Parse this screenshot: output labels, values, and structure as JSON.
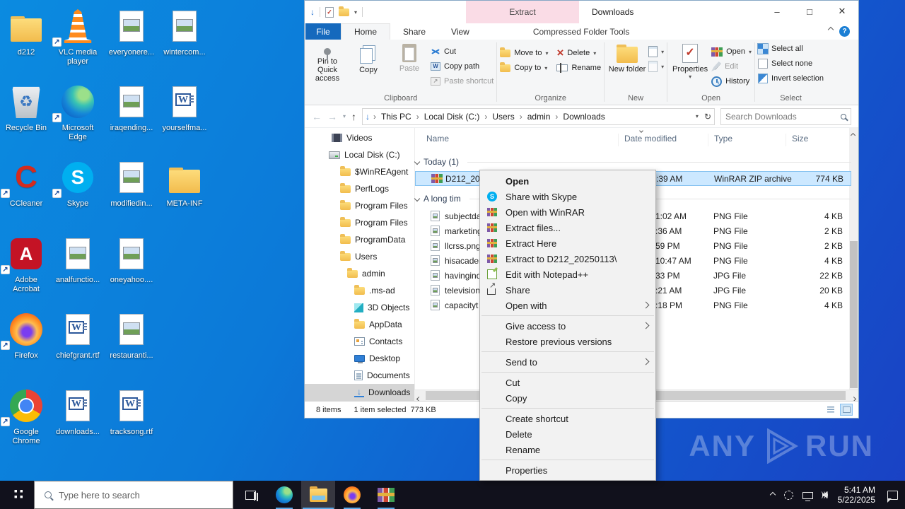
{
  "explorer": {
    "title": "Downloads",
    "contextual_header": "Extract",
    "contextual_tab": "Compressed Folder Tools",
    "tabs": [
      {
        "label": "File"
      },
      {
        "label": "Home"
      },
      {
        "label": "Share"
      },
      {
        "label": "View"
      }
    ],
    "ribbon": {
      "clipboard": {
        "pin": "Pin to Quick access",
        "copy": "Copy",
        "paste": "Paste",
        "cut": "Cut",
        "copy_path": "Copy path",
        "paste_shortcut": "Paste shortcut",
        "group": "Clipboard"
      },
      "organize": {
        "move_to": "Move to",
        "copy_to": "Copy to",
        "del": "Delete",
        "rename": "Rename",
        "group": "Organize"
      },
      "newgrp": {
        "new_folder": "New folder",
        "group": "New"
      },
      "opengrp": {
        "properties": "Properties",
        "open": "Open",
        "edit": "Edit",
        "history": "History",
        "group": "Open"
      },
      "selectgrp": {
        "select_all": "Select all",
        "select_none": "Select none",
        "invert": "Invert selection",
        "group": "Select"
      }
    },
    "address": {
      "breadcrumb": [
        "This PC",
        "Local Disk (C:)",
        "Users",
        "admin",
        "Downloads"
      ],
      "search_placeholder": "Search Downloads"
    },
    "columns": [
      "Name",
      "Date modified",
      "Type",
      "Size"
    ],
    "nav_items": [
      {
        "label": "Videos",
        "icon": "video",
        "indent": 38
      },
      {
        "label": "Local Disk (C:)",
        "icon": "disk",
        "indent": 34
      },
      {
        "label": "$WinREAgent",
        "icon": "folder",
        "indent": 50
      },
      {
        "label": "PerfLogs",
        "icon": "folder",
        "indent": 50
      },
      {
        "label": "Program Files",
        "icon": "folder",
        "indent": 50
      },
      {
        "label": "Program Files",
        "icon": "folder",
        "indent": 50
      },
      {
        "label": "ProgramData",
        "icon": "folder",
        "indent": 50
      },
      {
        "label": "Users",
        "icon": "folder",
        "indent": 50
      },
      {
        "label": "admin",
        "icon": "folder",
        "indent": 60
      },
      {
        "label": ".ms-ad",
        "icon": "folder",
        "indent": 70
      },
      {
        "label": "3D Objects",
        "icon": "cube",
        "indent": 70
      },
      {
        "label": "AppData",
        "icon": "folder",
        "indent": 70
      },
      {
        "label": "Contacts",
        "icon": "card",
        "indent": 70
      },
      {
        "label": "Desktop",
        "icon": "monitor",
        "indent": 70
      },
      {
        "label": "Documents",
        "icon": "doc",
        "indent": 70
      },
      {
        "label": "Downloads",
        "icon": "download",
        "indent": 70,
        "selected": true
      }
    ],
    "groups": [
      "Today (1)",
      "A long tim"
    ],
    "rows": [
      {
        "name": "D212_202",
        "date": ":39 AM",
        "type": "WinRAR ZIP archive",
        "size": "774 KB",
        "icon": "winrar",
        "selected": true
      },
      {
        "name": "subjectda",
        "date": "1:02 AM",
        "type": "PNG File",
        "size": "4 KB",
        "icon": "img"
      },
      {
        "name": "marketing",
        "date": ":36 AM",
        "type": "PNG File",
        "size": "2 KB",
        "icon": "img"
      },
      {
        "name": "llcrss.png",
        "date": "59 PM",
        "type": "PNG File",
        "size": "2 KB",
        "icon": "img"
      },
      {
        "name": "hisacader",
        "date": "10:47 AM",
        "type": "PNG File",
        "size": "4 KB",
        "icon": "img"
      },
      {
        "name": "havingind",
        "date": "33 PM",
        "type": "JPG File",
        "size": "22 KB",
        "icon": "img"
      },
      {
        "name": "television",
        "date": ":21 AM",
        "type": "JPG File",
        "size": "20 KB",
        "icon": "img"
      },
      {
        "name": "capacityt",
        "date": ":18 PM",
        "type": "PNG File",
        "size": "4 KB",
        "icon": "img"
      }
    ],
    "status": {
      "items_count": "8 items",
      "selection": "1 item selected",
      "selection_size": "773 KB"
    }
  },
  "context_menu": {
    "items": [
      {
        "label": "Open",
        "bold": true
      },
      {
        "label": "Share with Skype",
        "icon": "skype"
      },
      {
        "label": "Open with WinRAR",
        "icon": "winrar"
      },
      {
        "label": "Extract files...",
        "icon": "winrar"
      },
      {
        "label": "Extract Here",
        "icon": "winrar"
      },
      {
        "label": "Extract to D212_20250113\\",
        "icon": "winrar"
      },
      {
        "label": "Edit with Notepad++",
        "icon": "npp"
      },
      {
        "label": "Share",
        "icon": "share"
      },
      {
        "label": "Open with",
        "submenu": true
      },
      {
        "separator": true
      },
      {
        "label": "Give access to",
        "submenu": true
      },
      {
        "label": "Restore previous versions"
      },
      {
        "separator": true
      },
      {
        "label": "Send to",
        "submenu": true
      },
      {
        "separator": true
      },
      {
        "label": "Cut"
      },
      {
        "label": "Copy"
      },
      {
        "separator": true
      },
      {
        "label": "Create shortcut"
      },
      {
        "label": "Delete"
      },
      {
        "label": "Rename"
      },
      {
        "separator": true
      },
      {
        "label": "Properties"
      }
    ]
  },
  "desktop": {
    "icons": [
      {
        "label": "d212",
        "type": "folder",
        "col": 1,
        "row": 1
      },
      {
        "label": "VLC media player",
        "type": "vlc",
        "col": 2,
        "row": 1,
        "shortcut": true
      },
      {
        "label": "everyonere...",
        "type": "img",
        "col": 3,
        "row": 1
      },
      {
        "label": "wintercom...",
        "type": "img",
        "col": 4,
        "row": 1
      },
      {
        "label": "Recycle Bin",
        "type": "bin",
        "col": 1,
        "row": 2
      },
      {
        "label": "Microsoft Edge",
        "type": "edge",
        "col": 2,
        "row": 2,
        "shortcut": true
      },
      {
        "label": "iraqending...",
        "type": "img",
        "col": 3,
        "row": 2
      },
      {
        "label": "yourselfma...",
        "type": "word",
        "col": 4,
        "row": 2
      },
      {
        "label": "CCleaner",
        "type": "ccleaner",
        "col": 1,
        "row": 3,
        "shortcut": true
      },
      {
        "label": "Skype",
        "type": "skype",
        "col": 2,
        "row": 3,
        "shortcut": true
      },
      {
        "label": "modifiedin...",
        "type": "img",
        "col": 3,
        "row": 3
      },
      {
        "label": "META-INF",
        "type": "folder",
        "col": 4,
        "row": 3
      },
      {
        "label": "Adobe Acrobat",
        "type": "acrobat",
        "col": 1,
        "row": 4,
        "shortcut": true
      },
      {
        "label": "analfunctio...",
        "type": "img",
        "col": 2,
        "row": 4
      },
      {
        "label": "oneyahoo....",
        "type": "img",
        "col": 3,
        "row": 4
      },
      {
        "label": "Firefox",
        "type": "firefox",
        "col": 1,
        "row": 5,
        "shortcut": true
      },
      {
        "label": "chiefgrant.rtf",
        "type": "word",
        "col": 2,
        "row": 5
      },
      {
        "label": "restauranti...",
        "type": "img",
        "col": 3,
        "row": 5
      },
      {
        "label": "Google Chrome",
        "type": "chrome",
        "col": 1,
        "row": 6,
        "shortcut": true
      },
      {
        "label": "downloads...",
        "type": "word",
        "col": 2,
        "row": 6
      },
      {
        "label": "tracksong.rtf",
        "type": "word",
        "col": 3,
        "row": 6
      }
    ]
  },
  "taskbar": {
    "search_placeholder": "Type here to search",
    "apps": [
      {
        "name": "edge",
        "running": true
      },
      {
        "name": "explorer",
        "running": true,
        "active": true
      },
      {
        "name": "firefox",
        "running": true
      },
      {
        "name": "winrar",
        "running": true
      }
    ],
    "clock_time": "5:41 AM",
    "clock_date": "5/22/2025"
  },
  "watermark": {
    "left": "ANY",
    "right": "RUN"
  }
}
